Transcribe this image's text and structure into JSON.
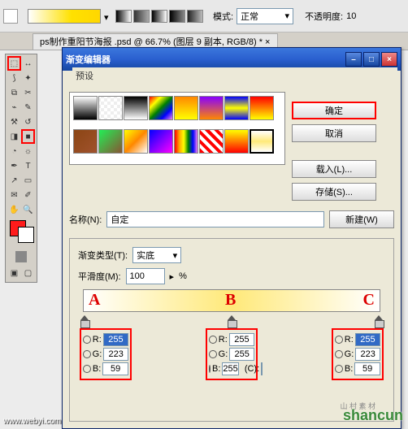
{
  "topbar": {
    "mode_label": "模式:",
    "mode_value": "正常",
    "opacity_label": "不透明度:",
    "opacity_value": "10"
  },
  "doc_tab": "ps制作重阳节海报 .psd @ 66.7% (图层 9 副本, RGB/8) * ×",
  "dialog": {
    "title": "渐变编辑器",
    "presets_label": "预设",
    "buttons": {
      "ok": "确定",
      "cancel": "取消",
      "load": "载入(L)...",
      "save": "存储(S)...",
      "new": "新建(W)"
    },
    "name_label": "名称(N):",
    "name_value": "自定",
    "type_label": "渐变类型(T):",
    "type_value": "实底",
    "smooth_label": "平滑度(M):",
    "smooth_value": "100",
    "percent": "%",
    "annotations": {
      "a": "A",
      "b": "B",
      "c": "C"
    },
    "rgb_labels": {
      "r": "R:",
      "g": "G:",
      "b": "B:",
      "loc": "(C):"
    },
    "stops": {
      "a": {
        "r": "255",
        "g": "223",
        "b": "59"
      },
      "b": {
        "r": "255",
        "g": "255",
        "b": "255"
      },
      "c": {
        "r": "255",
        "g": "223",
        "b": "59"
      }
    }
  },
  "watermarks": {
    "site1": "www.webyi.com",
    "site2": "shancun",
    "site3": "山 村 素 材"
  }
}
